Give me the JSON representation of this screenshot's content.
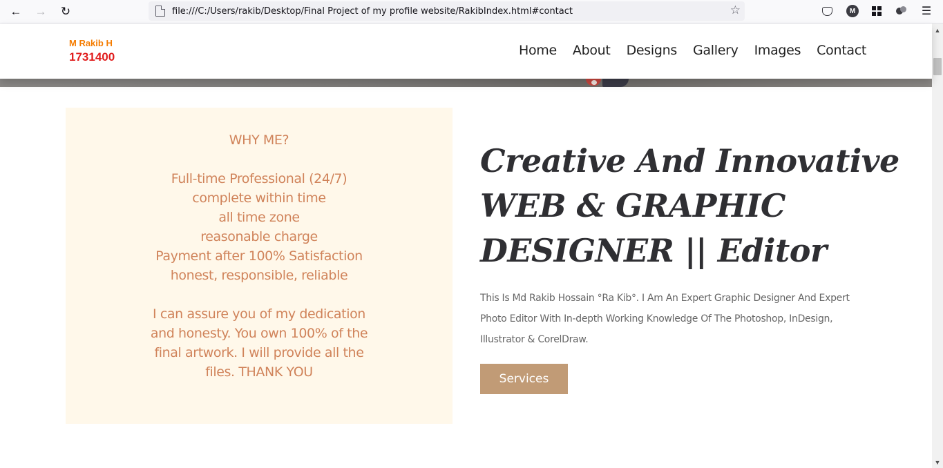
{
  "browser": {
    "url": "file:///C:/Users/rakib/Desktop/Final Project of my profile website/RakibIndex.html#contact",
    "back_icon": "←",
    "forward_icon": "→",
    "reload_icon": "↻",
    "star_icon": "☆",
    "menu_icon": "☰",
    "account_initial": "M"
  },
  "header": {
    "brand_name": "M Rakib H",
    "brand_id": "1731400",
    "nav": [
      {
        "label": "Home"
      },
      {
        "label": "About"
      },
      {
        "label": "Designs"
      },
      {
        "label": "Gallery"
      },
      {
        "label": "Images"
      },
      {
        "label": "Contact"
      }
    ]
  },
  "why_me": {
    "title": "WHY ME?",
    "points": [
      "Full-time Professional (24/7)",
      "complete within time",
      "all time zone",
      "reasonable charge",
      "Payment after 100% Satisfaction",
      "honest, responsible, reliable"
    ],
    "assurance": [
      "I can assure you of my dedication",
      "and honesty. You own 100% of the",
      "final artwork. I will provide all the",
      "files. THANK YOU"
    ]
  },
  "hero": {
    "headline_lines": [
      "Creative And Innovative",
      "WEB & GRAPHIC",
      "DESIGNER || Editor"
    ],
    "bio_lines": [
      "This Is Md Rakib Hossain °Ra Kib°. I Am An Expert Graphic Designer And Expert",
      "Photo Editor With In-depth Working Knowledge Of The Photoshop, InDesign,",
      "Illustrator & CorelDraw."
    ],
    "button_label": "Services"
  },
  "colors": {
    "brand_name": "#f57c00",
    "brand_id": "#e11d1d",
    "panel_bg": "#fff8ea",
    "panel_text": "#d0835a",
    "button_bg": "#c19b76",
    "headline": "#2f2f33"
  },
  "icons": [
    "arrow-left-icon",
    "arrow-right-icon",
    "reload-icon",
    "page-icon",
    "star-icon",
    "pocket-icon",
    "account-icon",
    "extensions-grid-icon",
    "container-icon",
    "menu-icon"
  ]
}
